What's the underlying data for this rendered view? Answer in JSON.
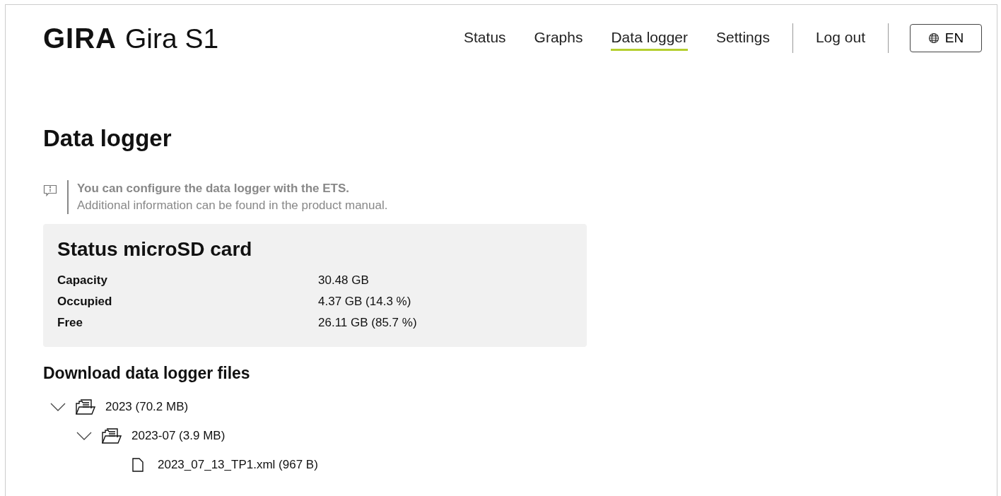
{
  "header": {
    "brand": "GIRA",
    "product": "Gira S1",
    "nav": [
      {
        "label": "Status",
        "selected": false
      },
      {
        "label": "Graphs",
        "selected": false
      },
      {
        "label": "Data logger",
        "selected": true
      },
      {
        "label": "Settings",
        "selected": false
      }
    ],
    "logout": "Log out",
    "language": "EN"
  },
  "page_title": "Data logger",
  "info": {
    "bold": "You can configure the data logger with the ETS.",
    "text": "Additional information can be found in the product manual."
  },
  "status_card": {
    "title": "Status microSD card",
    "rows": [
      {
        "label": "Capacity",
        "value": "30.48 GB"
      },
      {
        "label": "Occupied",
        "value": "4.37 GB (14.3 %)"
      },
      {
        "label": "Free",
        "value": "26.11 GB (85.7 %)"
      }
    ]
  },
  "downloads": {
    "title": "Download data logger files",
    "tree": [
      {
        "kind": "folder",
        "label": "2023 (70.2 MB)",
        "expanded": true,
        "children": [
          {
            "kind": "folder",
            "label": "2023-07 (3.9 MB)",
            "expanded": true,
            "children": [
              {
                "kind": "file",
                "label": "2023_07_13_TP1.xml (967 B)"
              }
            ]
          }
        ]
      }
    ]
  }
}
